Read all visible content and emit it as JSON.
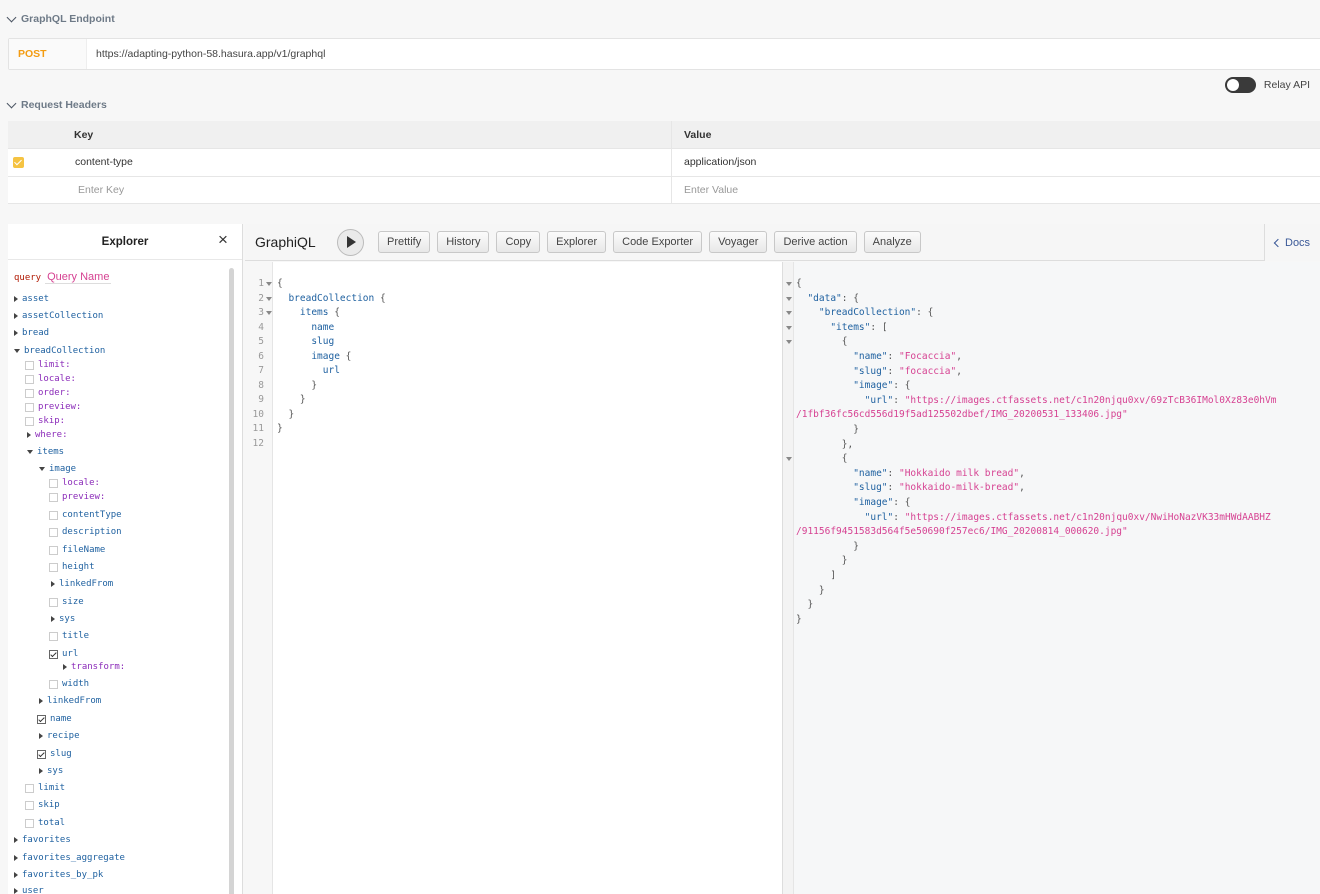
{
  "endpoint_section": {
    "title": "GraphQL Endpoint",
    "method": "POST",
    "url": "https://adapting-python-58.hasura.app/v1/graphql"
  },
  "relay": {
    "label": "Relay API",
    "enabled": false
  },
  "headers_section": {
    "title": "Request Headers",
    "col_key": "Key",
    "col_value": "Value",
    "rows": [
      {
        "checked": true,
        "key": "content-type",
        "value": "application/json"
      }
    ],
    "key_placeholder": "Enter Key",
    "value_placeholder": "Enter Value"
  },
  "explorer": {
    "title": "Explorer",
    "query_kw": "query",
    "query_name_placeholder": "Query Name",
    "items": [
      {
        "label": "asset",
        "kind": "field",
        "ctl": "tri-r"
      },
      {
        "label": "assetCollection",
        "kind": "field",
        "ctl": "tri-r"
      },
      {
        "label": "bread",
        "kind": "field",
        "ctl": "tri-r"
      },
      {
        "label": "breadCollection",
        "kind": "field",
        "ctl": "tri-d"
      },
      {
        "label": "limit:",
        "kind": "arg",
        "ctl": "cbx"
      },
      {
        "label": "locale:",
        "kind": "arg",
        "ctl": "cbx"
      },
      {
        "label": "order:",
        "kind": "arg",
        "ctl": "cbx"
      },
      {
        "label": "preview:",
        "kind": "arg",
        "ctl": "cbx"
      },
      {
        "label": "skip:",
        "kind": "arg",
        "ctl": "cbx"
      },
      {
        "label": "where:",
        "kind": "arg",
        "ctl": "tri-r"
      },
      {
        "label": "items",
        "kind": "field",
        "ctl": "tri-d"
      },
      {
        "label": "image",
        "kind": "field",
        "ctl": "tri-d"
      },
      {
        "label": "locale:",
        "kind": "arg",
        "ctl": "cbx"
      },
      {
        "label": "preview:",
        "kind": "arg",
        "ctl": "cbx"
      },
      {
        "label": "contentType",
        "kind": "field",
        "ctl": "cbx"
      },
      {
        "label": "description",
        "kind": "field",
        "ctl": "cbx"
      },
      {
        "label": "fileName",
        "kind": "field",
        "ctl": "cbx"
      },
      {
        "label": "height",
        "kind": "field",
        "ctl": "cbx"
      },
      {
        "label": "linkedFrom",
        "kind": "field",
        "ctl": "tri-r"
      },
      {
        "label": "size",
        "kind": "field",
        "ctl": "cbx"
      },
      {
        "label": "sys",
        "kind": "field",
        "ctl": "tri-r"
      },
      {
        "label": "title",
        "kind": "field",
        "ctl": "cbx"
      },
      {
        "label": "url",
        "kind": "field",
        "ctl": "cbx-on"
      },
      {
        "label": "transform:",
        "kind": "arg",
        "ctl": "tri-r"
      },
      {
        "label": "width",
        "kind": "field",
        "ctl": "cbx"
      },
      {
        "label": "linkedFrom",
        "kind": "field",
        "ctl": "tri-r"
      },
      {
        "label": "name",
        "kind": "field",
        "ctl": "cbx-on"
      },
      {
        "label": "recipe",
        "kind": "field",
        "ctl": "tri-r"
      },
      {
        "label": "slug",
        "kind": "field",
        "ctl": "cbx-on"
      },
      {
        "label": "sys",
        "kind": "field",
        "ctl": "tri-r"
      },
      {
        "label": "limit",
        "kind": "field",
        "ctl": "cbx"
      },
      {
        "label": "skip",
        "kind": "field",
        "ctl": "cbx"
      },
      {
        "label": "total",
        "kind": "field",
        "ctl": "cbx"
      },
      {
        "label": "favorites",
        "kind": "field",
        "ctl": "tri-r"
      },
      {
        "label": "favorites_aggregate",
        "kind": "field",
        "ctl": "tri-r"
      },
      {
        "label": "favorites_by_pk",
        "kind": "field",
        "ctl": "tri-r"
      },
      {
        "label": "user",
        "kind": "field",
        "ctl": "tri-r"
      }
    ]
  },
  "toolbar": {
    "title": "GraphiQL",
    "buttons": [
      "Prettify",
      "History",
      "Copy",
      "Explorer",
      "Code Exporter",
      "Voyager",
      "Derive action",
      "Analyze"
    ],
    "docs": "Docs"
  },
  "query_lines": [
    "{",
    "  breadCollection {",
    "    items {",
    "      name",
    "      slug",
    "      image {",
    "        url",
    "      }",
    "    }",
    "  }",
    "}",
    ""
  ],
  "result_lines": [
    "{",
    "  \"data\": {",
    "    \"breadCollection\": {",
    "      \"items\": [",
    "        {",
    "          \"name\": \"Focaccia\",",
    "          \"slug\": \"focaccia\",",
    "          \"image\": {",
    "            \"url\": \"https://images.ctfassets.net/c1n20njqu0xv/69zTcB36IMol0Xz83e0hVm",
    "/1fbf36fc56cd556d19f5ad125502dbef/IMG_20200531_133406.jpg\"",
    "          }",
    "        },",
    "        {",
    "          \"name\": \"Hokkaido milk bread\",",
    "          \"slug\": \"hokkaido-milk-bread\",",
    "          \"image\": {",
    "            \"url\": \"https://images.ctfassets.net/c1n20njqu0xv/NwiHoNazVK33mHWdAABHZ",
    "/91156f9451583d564f5e50690f257ec6/IMG_20200814_000620.jpg\"",
    "          }",
    "        }",
    "      ]",
    "    }",
    "  }",
    "}"
  ],
  "colors": {
    "method": "#f39c12",
    "checkbox": "#f5c342",
    "field": "#1f61a0",
    "arg": "#8b2bb9",
    "string": "#d64292",
    "keyword": "#b11a04"
  }
}
